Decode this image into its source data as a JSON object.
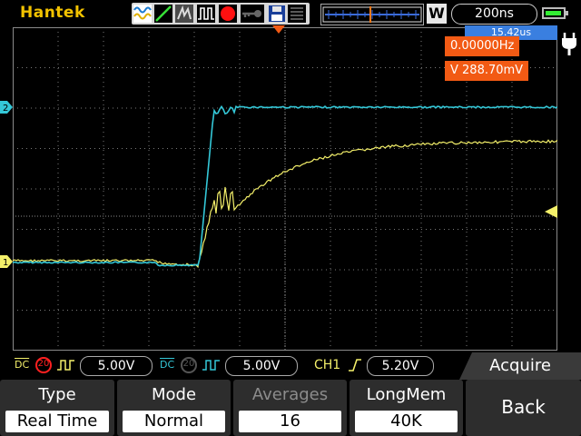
{
  "brand": "Hantek",
  "header": {
    "run_icons": [
      "waveform-icon",
      "slope-icon",
      "persistence-icon",
      "pulse-icon",
      "record-icon",
      "key-icon",
      "save-icon",
      "menu-icon"
    ],
    "mem_marker": "W",
    "timebase": "200ns",
    "trigger_position": "15.42us"
  },
  "readouts": {
    "frequency": "0.00000Hz",
    "voltage": "V 288.70mV"
  },
  "channel_markers": {
    "ch1": "1",
    "ch2": "2"
  },
  "status": {
    "ch1_coupling": "DC",
    "ch1_bw": "20",
    "ch1_scale": "5.00V",
    "ch2_coupling": "DC",
    "ch2_bw": "20",
    "ch2_scale": "5.00V",
    "trigger_source": "CH1",
    "trigger_level": "5.20V"
  },
  "menu_title": "Acquire",
  "softkeys": [
    {
      "title": "Type",
      "value": "Real Time",
      "enabled": true
    },
    {
      "title": "Mode",
      "value": "Normal",
      "enabled": true
    },
    {
      "title": "Averages",
      "value": "16",
      "enabled": false
    },
    {
      "title": "LongMem",
      "value": "40K",
      "enabled": true
    },
    {
      "title": "Back",
      "value": "",
      "enabled": true
    }
  ],
  "colors": {
    "ch1": "#f4f06a",
    "ch2": "#34c8d8",
    "brand": "#f2c200",
    "readout_bg": "#f25a14",
    "trigger_badge": "#3a7fe0",
    "grid": "#7a7a7a"
  }
}
